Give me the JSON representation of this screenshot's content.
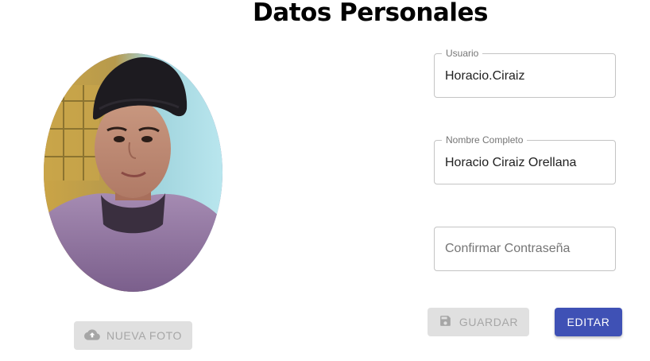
{
  "page": {
    "title": "Datos Personales"
  },
  "photo": {
    "upload_label": "Nueva Foto",
    "upload_icon": "cloud-upload-icon"
  },
  "form": {
    "usuario": {
      "label": "Usuario",
      "value": "Horacio.Ciraiz"
    },
    "nombre_completo": {
      "label": "Nombre Completo",
      "value": "Horacio Ciraiz Orellana"
    },
    "confirmar_contrasena": {
      "placeholder": "Confirmar Contraseña",
      "value": ""
    }
  },
  "actions": {
    "save_label": "Guardar",
    "save_icon": "floppy-disk-icon",
    "edit_label": "Editar"
  },
  "colors": {
    "primary": "#3f51b5",
    "disabled_bg": "#e0e0e0",
    "disabled_text": "#a6a6a6",
    "field_border": "#c4c4c4"
  }
}
